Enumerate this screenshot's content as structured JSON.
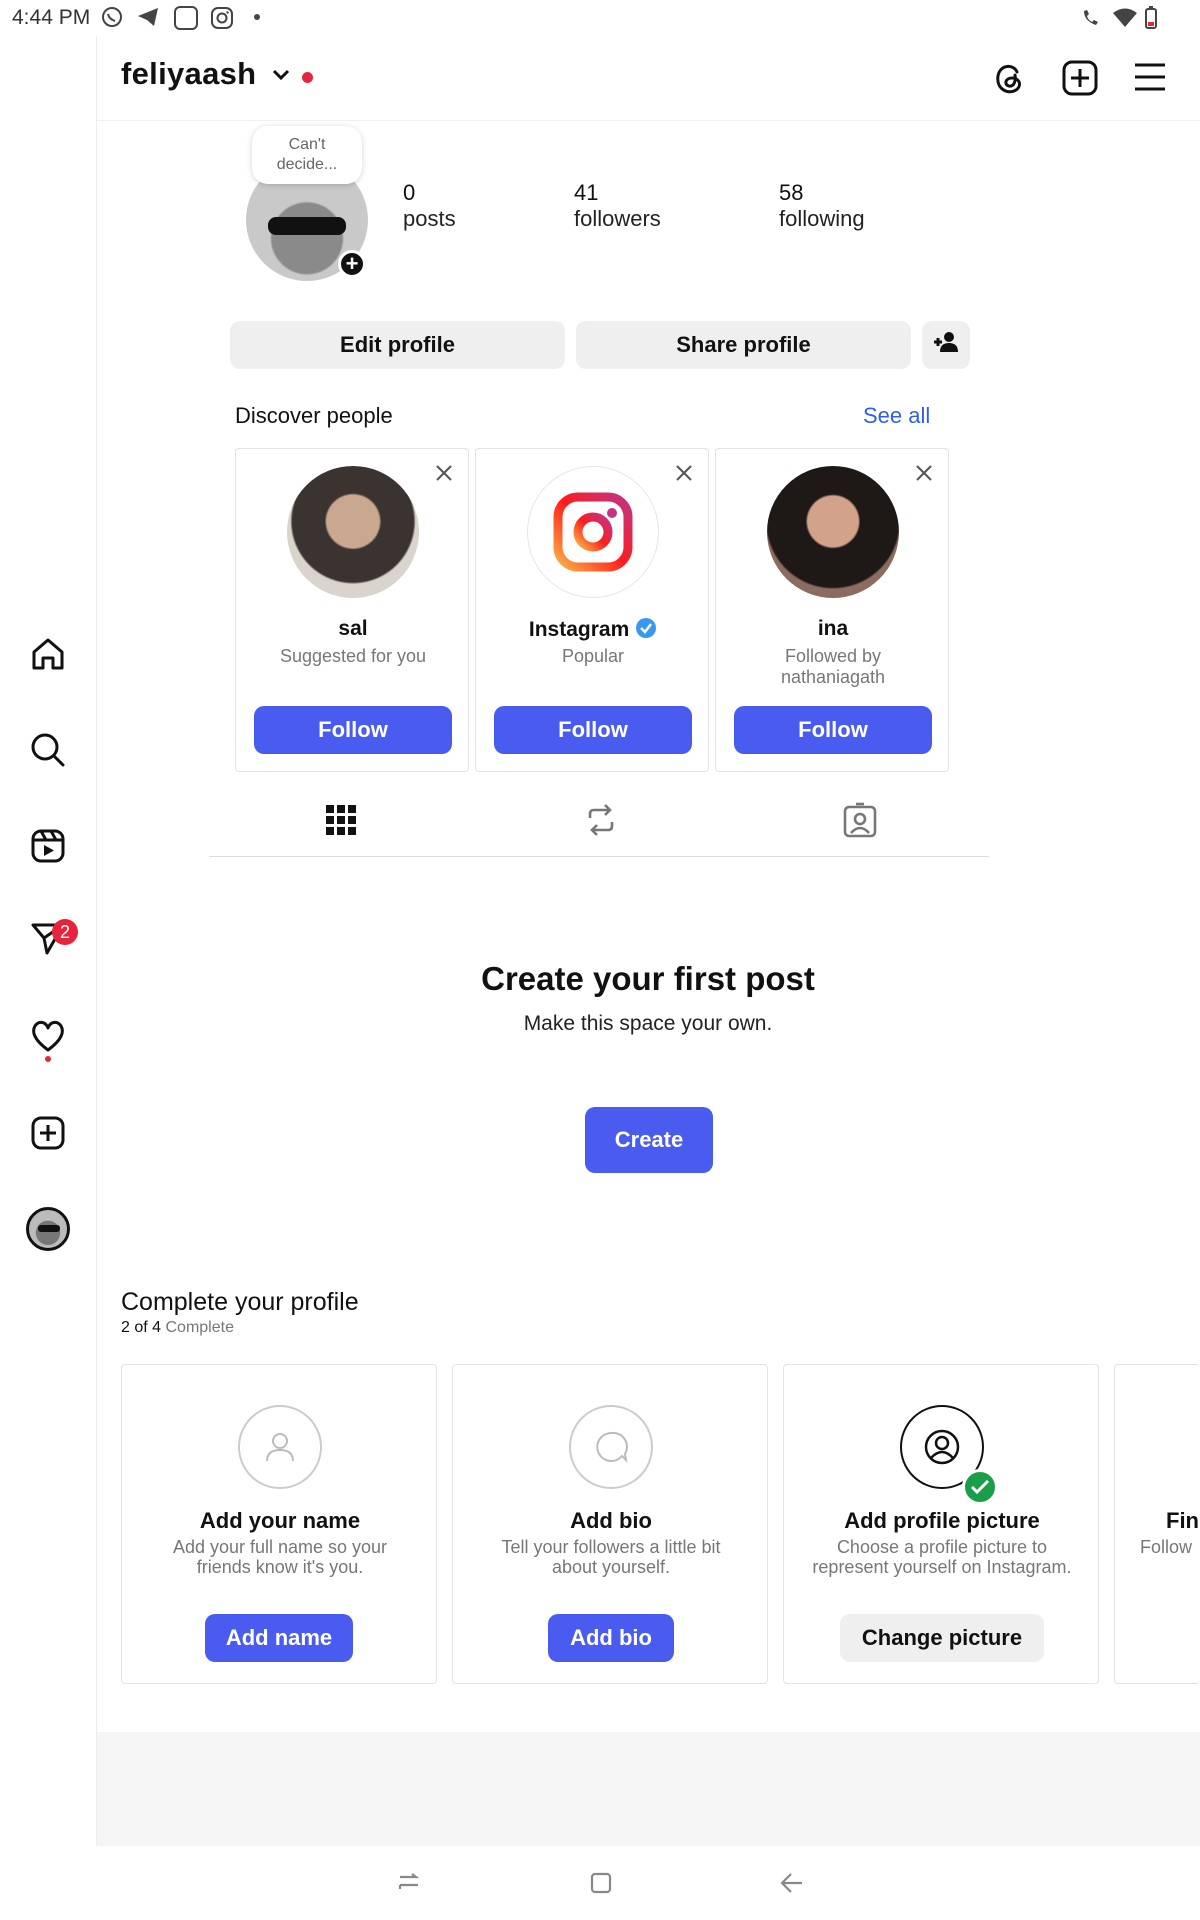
{
  "status_bar": {
    "time": "4:44 PM"
  },
  "header": {
    "username": "feliyaash"
  },
  "profile": {
    "note": "Can't decide...",
    "stats": [
      {
        "value": "0",
        "label": "posts"
      },
      {
        "value": "41",
        "label": "followers"
      },
      {
        "value": "58",
        "label": "following"
      }
    ],
    "edit_label": "Edit profile",
    "share_label": "Share profile"
  },
  "discover": {
    "title": "Discover people",
    "see_all": "See all",
    "people": [
      {
        "name": "sal",
        "sub": "Suggested for you",
        "follow": "Follow"
      },
      {
        "name": "Instagram",
        "sub": "Popular",
        "follow": "Follow"
      },
      {
        "name": "ina",
        "sub": "Followed by nathaniagath",
        "follow": "Follow"
      }
    ]
  },
  "empty": {
    "title": "Create your first post",
    "subtitle": "Make this space your own.",
    "create": "Create"
  },
  "nav": {
    "messages_badge": "2"
  },
  "complete": {
    "title": "Complete your profile",
    "progress": "2 of 4",
    "progress_suffix": "Complete",
    "cards": [
      {
        "title": "Add your name",
        "desc": "Add your full name so your friends know it's you.",
        "button": "Add name"
      },
      {
        "title": "Add bio",
        "desc": "Tell your followers a little bit about yourself.",
        "button": "Add bio"
      },
      {
        "title": "Add profile picture",
        "desc": "Choose a profile picture to represent yourself on Instagram.",
        "button": "Change picture"
      },
      {
        "title": "Fin",
        "desc": "Follow"
      }
    ]
  },
  "colors": {
    "accent": "#4a5cf0",
    "badge": "#e8243c",
    "verified": "#3897f0",
    "done": "#1a9e4a"
  }
}
